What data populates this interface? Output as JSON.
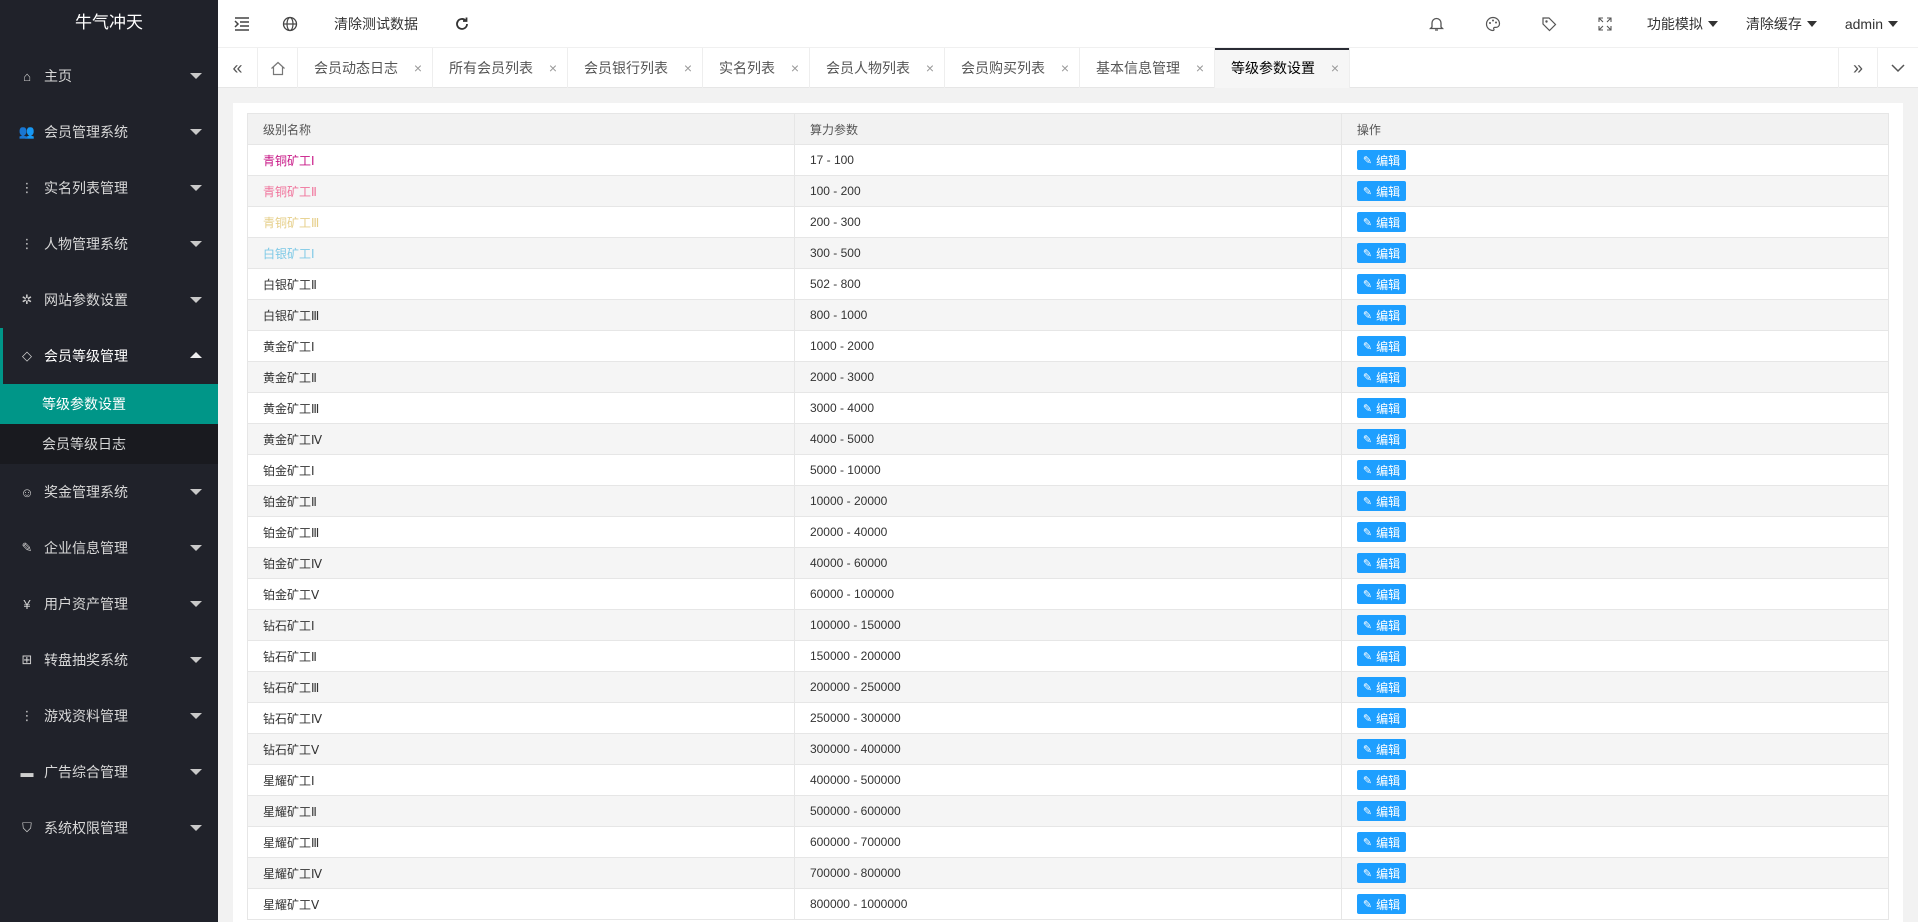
{
  "app": {
    "logo": "牛气冲天"
  },
  "sidebar": {
    "items": [
      {
        "label": "主页",
        "icon": "home-icon",
        "glyph": "⌂"
      },
      {
        "label": "会员管理系统",
        "icon": "users-icon",
        "glyph": "👥"
      },
      {
        "label": "实名列表管理",
        "icon": "more-vertical-icon",
        "glyph": "⋮"
      },
      {
        "label": "人物管理系统",
        "icon": "more-vertical-icon",
        "glyph": "⋮"
      },
      {
        "label": "网站参数设置",
        "icon": "gear-icon",
        "glyph": "✲"
      },
      {
        "label": "会员等级管理",
        "icon": "diamond-icon",
        "glyph": "◇"
      },
      {
        "label": "奖金管理系统",
        "icon": "smile-icon",
        "glyph": "☺"
      },
      {
        "label": "企业信息管理",
        "icon": "edit-doc-icon",
        "glyph": "✎"
      },
      {
        "label": "用户资产管理",
        "icon": "yen-icon",
        "glyph": "¥"
      },
      {
        "label": "转盘抽奖系统",
        "icon": "apps-icon",
        "glyph": "⊞"
      },
      {
        "label": "游戏资料管理",
        "icon": "more-vertical-icon",
        "glyph": "⋮"
      },
      {
        "label": "广告综合管理",
        "icon": "billboard-icon",
        "glyph": "▬"
      },
      {
        "label": "系统权限管理",
        "icon": "shield-icon",
        "glyph": "⛉"
      }
    ],
    "submenu": {
      "active": "等级参数设置",
      "other": "会员等级日志"
    }
  },
  "header": {
    "clear_test_data": "清除测试数据",
    "function_sim": "功能模拟",
    "clear_cache": "清除缓存",
    "user": "admin"
  },
  "tabs": [
    {
      "label": "会员动态日志"
    },
    {
      "label": "所有会员列表"
    },
    {
      "label": "会员银行列表"
    },
    {
      "label": "实名列表"
    },
    {
      "label": "会员人物列表"
    },
    {
      "label": "会员购买列表"
    },
    {
      "label": "基本信息管理"
    },
    {
      "label": "等级参数设置"
    }
  ],
  "table": {
    "headers": {
      "name": "级别名称",
      "param": "算力参数",
      "action": "操作"
    },
    "edit_label": "编辑",
    "rows": [
      {
        "name": "青铜矿工Ⅰ",
        "param": "17 - 100",
        "color": "#c71585"
      },
      {
        "name": "青铜矿工Ⅱ",
        "param": "100 - 200",
        "color": "#f0749c"
      },
      {
        "name": "青铜矿工Ⅲ",
        "param": "200 - 300",
        "color": "#e6cf8a"
      },
      {
        "name": "白银矿工Ⅰ",
        "param": "300 - 500",
        "color": "#7ec9e6"
      },
      {
        "name": "白银矿工Ⅱ",
        "param": "502 - 800",
        "color": "#333333"
      },
      {
        "name": "白银矿工Ⅲ",
        "param": "800 - 1000",
        "color": "#333333"
      },
      {
        "name": "黄金矿工Ⅰ",
        "param": "1000 - 2000",
        "color": "#333333"
      },
      {
        "name": "黄金矿工Ⅱ",
        "param": "2000 - 3000",
        "color": "#333333"
      },
      {
        "name": "黄金矿工Ⅲ",
        "param": "3000 - 4000",
        "color": "#333333"
      },
      {
        "name": "黄金矿工Ⅳ",
        "param": "4000 - 5000",
        "color": "#333333"
      },
      {
        "name": "铂金矿工Ⅰ",
        "param": "5000 - 10000",
        "color": "#333333"
      },
      {
        "name": "铂金矿工Ⅱ",
        "param": "10000 - 20000",
        "color": "#333333"
      },
      {
        "name": "铂金矿工Ⅲ",
        "param": "20000 - 40000",
        "color": "#333333"
      },
      {
        "name": "铂金矿工Ⅳ",
        "param": "40000 - 60000",
        "color": "#333333"
      },
      {
        "name": "铂金矿工Ⅴ",
        "param": "60000 - 100000",
        "color": "#333333"
      },
      {
        "name": "钻石矿工Ⅰ",
        "param": "100000 - 150000",
        "color": "#333333"
      },
      {
        "name": "钻石矿工Ⅱ",
        "param": "150000 - 200000",
        "color": "#333333"
      },
      {
        "name": "钻石矿工Ⅲ",
        "param": "200000 - 250000",
        "color": "#333333"
      },
      {
        "name": "钻石矿工Ⅳ",
        "param": "250000 - 300000",
        "color": "#333333"
      },
      {
        "name": "钻石矿工Ⅴ",
        "param": "300000 - 400000",
        "color": "#333333"
      },
      {
        "name": "星耀矿工Ⅰ",
        "param": "400000 - 500000",
        "color": "#333333"
      },
      {
        "name": "星耀矿工Ⅱ",
        "param": "500000 - 600000",
        "color": "#333333"
      },
      {
        "name": "星耀矿工Ⅲ",
        "param": "600000 - 700000",
        "color": "#333333"
      },
      {
        "name": "星耀矿工Ⅳ",
        "param": "700000 - 800000",
        "color": "#333333"
      },
      {
        "name": "星耀矿工Ⅴ",
        "param": "800000 - 1000000",
        "color": "#333333"
      }
    ]
  }
}
